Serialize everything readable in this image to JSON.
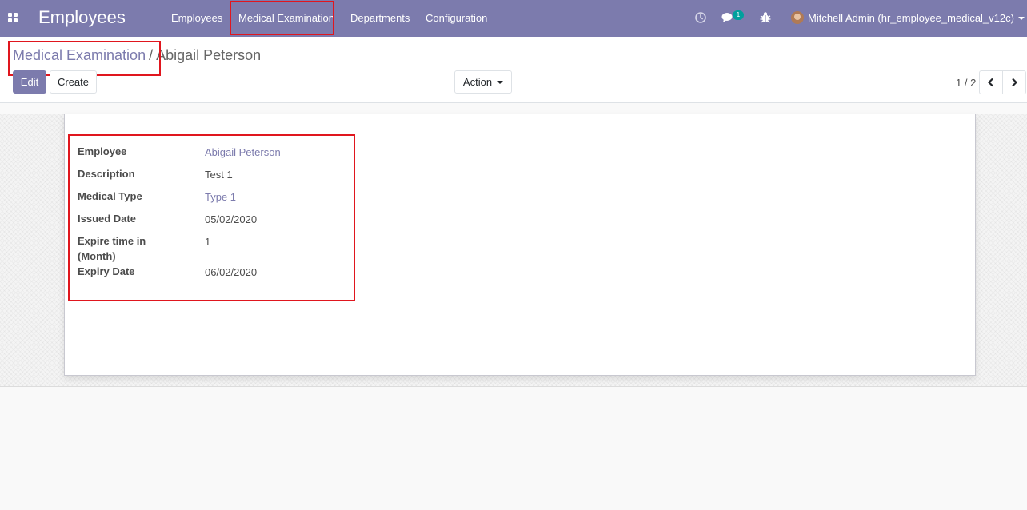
{
  "navbar": {
    "app_title": "Employees",
    "menu": [
      "Employees",
      "Medical Examination",
      "Departments",
      "Configuration"
    ],
    "chat_badge": "1",
    "user_name": "Mitchell Admin (hr_employee_medical_v12c)",
    "icons": {
      "apps": "apps-grid-icon",
      "activity": "clock-icon",
      "chat": "chat-icon",
      "debug": "bug-icon"
    }
  },
  "breadcrumb": {
    "parent": "Medical Examination",
    "separator": "/",
    "current": "Abigail Peterson"
  },
  "toolbar": {
    "edit_label": "Edit",
    "create_label": "Create",
    "action_label": "Action"
  },
  "pager": {
    "value": "1 / 2"
  },
  "form": {
    "fields": [
      {
        "label": "Employee",
        "value": "Abigail Peterson",
        "is_link": true
      },
      {
        "label": "Description",
        "value": "Test 1",
        "is_link": false
      },
      {
        "label": "Medical Type",
        "value": "Type 1",
        "is_link": true
      },
      {
        "label": "Issued Date",
        "value": "05/02/2020",
        "is_link": false
      },
      {
        "label": "Expire time in (Month)",
        "value": "1",
        "is_link": false
      },
      {
        "label": "Expiry Date",
        "value": "06/02/2020",
        "is_link": false
      }
    ]
  },
  "colors": {
    "brand": "#7c7bad",
    "highlight": "#e0161e",
    "badge": "#00a09d"
  }
}
